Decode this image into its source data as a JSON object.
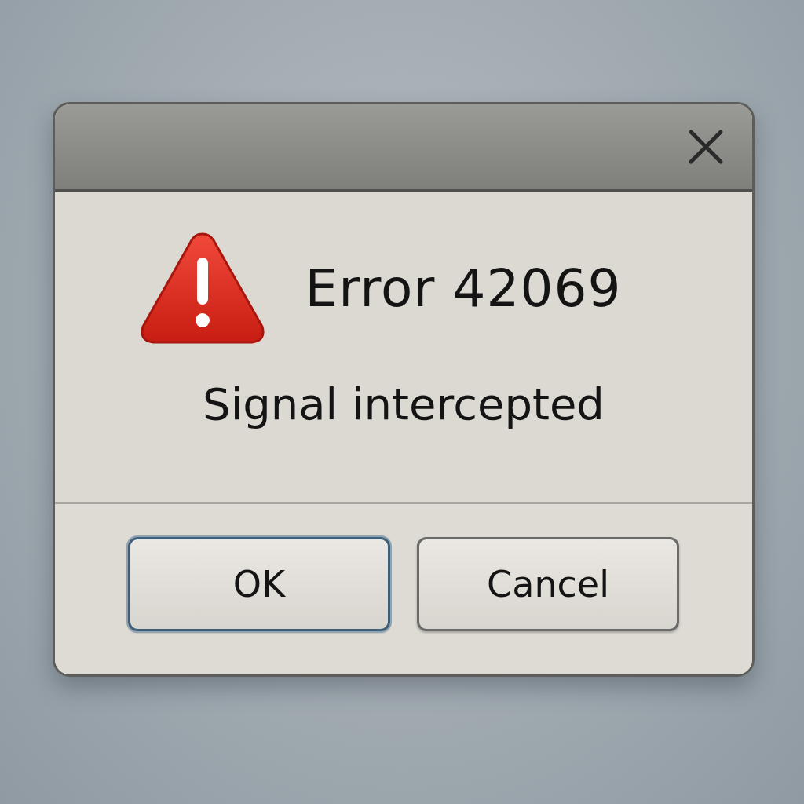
{
  "dialog": {
    "heading": "Error 42069",
    "message": "Signal intercepted",
    "buttons": [
      {
        "label": "OK",
        "focused": true
      },
      {
        "label": "Cancel",
        "focused": false
      }
    ]
  }
}
